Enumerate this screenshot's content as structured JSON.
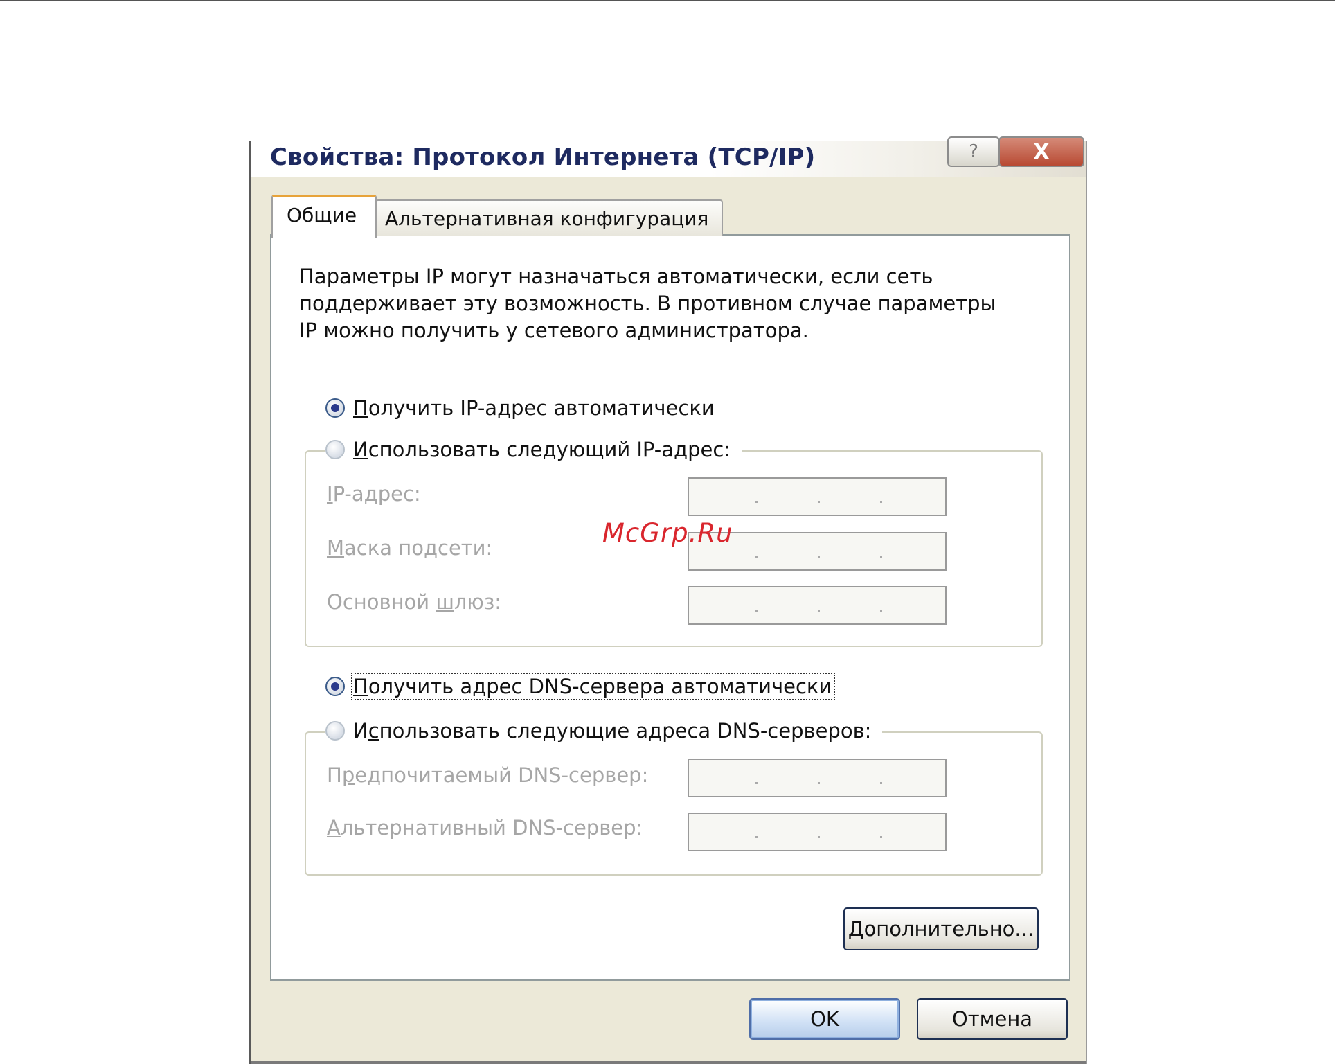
{
  "watermark": "McGrp.Ru",
  "dialog": {
    "title": "Свойства: Протокол Интернета (TCP/IP)",
    "help_glyph": "?",
    "close_glyph": "X",
    "tabs": [
      {
        "label": "Общие",
        "active": true
      },
      {
        "label": "Альтернативная конфигурация",
        "active": false
      }
    ],
    "description_lines": [
      "Параметры IP могут назначаться автоматически, если сеть",
      "поддерживает эту возможность. В противном случае параметры",
      "IP можно получить у сетевого администратора."
    ],
    "ip_auto": {
      "prefix": "",
      "accel": "П",
      "rest": "олучить IP-адрес автоматически",
      "checked": true
    },
    "ip_manual": {
      "prefix": "",
      "accel": "И",
      "rest": "спользовать следующий IP-адрес:",
      "checked": false
    },
    "ip_fields": [
      {
        "accel": "I",
        "rest": "P-адрес:",
        "prefix": "",
        "value": ""
      },
      {
        "accel": "М",
        "rest": "аска подсети:",
        "prefix": "",
        "value": ""
      },
      {
        "accel": "ш",
        "rest": "люз:",
        "prefix": "Основной ",
        "value": ""
      }
    ],
    "dns_auto": {
      "prefix": "",
      "accel": "П",
      "rest": "олучить адрес DNS-сервера автоматически",
      "checked": true
    },
    "dns_manual": {
      "prefix": "И",
      "accel": "с",
      "rest": "пользовать следующие адреса DNS-серверов:",
      "checked": false
    },
    "dns_fields": [
      {
        "prefix": "П",
        "accel": "р",
        "rest": "едпочитаемый DNS-сервер:",
        "value": ""
      },
      {
        "prefix": "",
        "accel": "А",
        "rest": "льтернативный DNS-сервер:",
        "value": ""
      }
    ],
    "advanced_button": {
      "accel": "Д",
      "rest": "ополнительно..."
    },
    "ok_label": "OK",
    "cancel_label": "Отмена"
  }
}
